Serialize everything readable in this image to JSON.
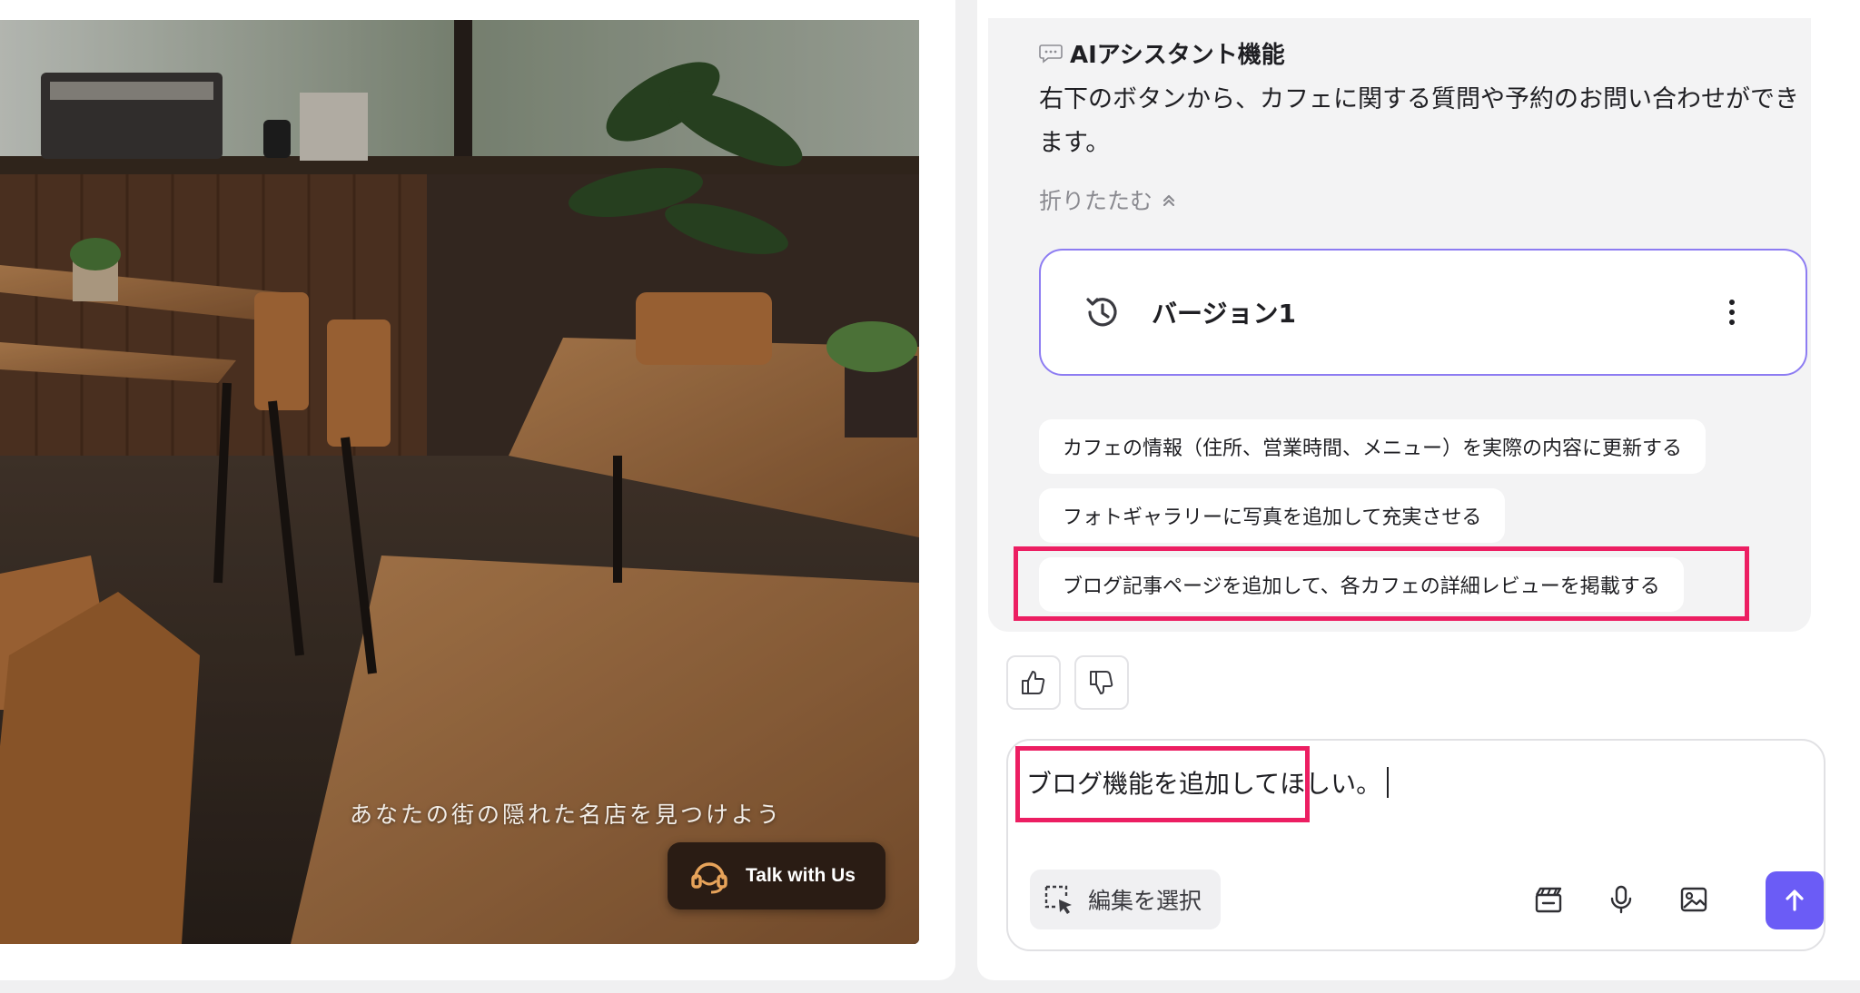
{
  "preview": {
    "tagline": "あなたの街の隠れた名店を見つけよう",
    "talk_button_label": "Talk with Us"
  },
  "assistant_message": {
    "feature_title": "AIアシスタント機能",
    "feature_description": "右下のボタンから、カフェに関する質問や予約のお問い合わせができます。",
    "collapse_label": "折りたたむ"
  },
  "version_card": {
    "label": "バージョン1"
  },
  "suggestions": [
    {
      "label": "カフェの情報（住所、営業時間、メニュー）を実際の内容に更新する"
    },
    {
      "label": "フォトギャラリーに写真を追加して充実させる"
    },
    {
      "label": "ブログ記事ページを追加して、各カフェの詳細レビューを掲載する"
    }
  ],
  "composer": {
    "input_text": "ブログ機能を追加してほしい。",
    "edit_select_label": "編集を選択"
  },
  "colors": {
    "accent": "#6b5cf6",
    "version_border": "#8d7cf2",
    "highlight": "#ec1e62",
    "talk_button_bg": "#2a1c14"
  },
  "icons": {
    "chat": "speech-bubble-icon",
    "collapse": "chevron-double-up-icon",
    "history": "history-icon",
    "more": "vertical-dots-icon",
    "thumbs_up": "thumbs-up-icon",
    "thumbs_down": "thumbs-down-icon",
    "edit_select": "select-cursor-icon",
    "clapper": "clapperboard-icon",
    "mic": "microphone-icon",
    "image": "image-icon",
    "send": "arrow-up-icon",
    "headset": "headset-icon"
  }
}
